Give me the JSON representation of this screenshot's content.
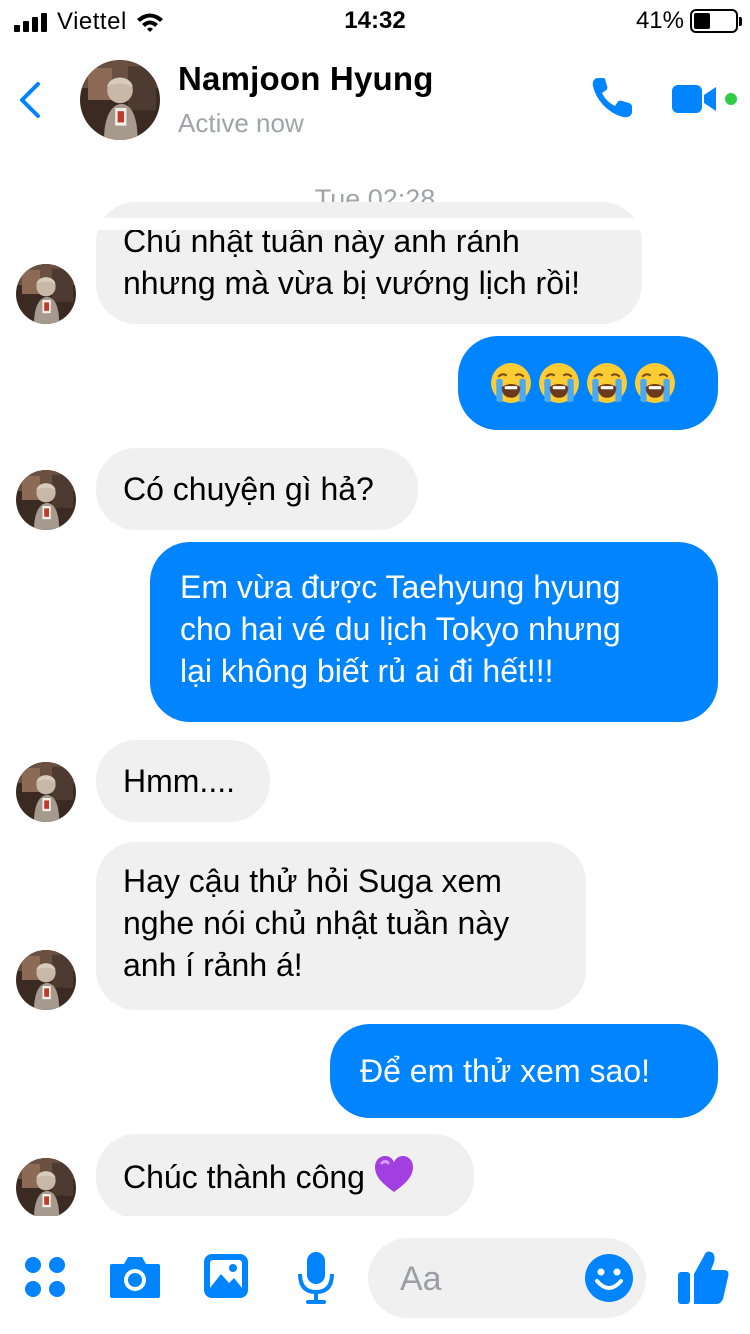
{
  "status_bar": {
    "carrier": "Viettel",
    "time": "14:32",
    "battery_percent": "41%",
    "battery_level": 0.41
  },
  "header": {
    "contact_name": "Namjoon Hyung",
    "status": "Active now"
  },
  "chat": {
    "timestamp": "Tue 02:28",
    "messages": [
      {
        "direction": "incoming",
        "lines": [
          "Chủ nhật tuần này anh rảnh",
          "nhưng mà vừa bị vướng lịch rồi!"
        ]
      },
      {
        "direction": "outgoing",
        "emoji": [
          "loudly-crying-face",
          "loudly-crying-face",
          "loudly-crying-face",
          "loudly-crying-face"
        ]
      },
      {
        "direction": "incoming",
        "lines": [
          "Có chuyện gì hả?"
        ]
      },
      {
        "direction": "outgoing",
        "lines": [
          "Em vừa được Taehyung hyung",
          "cho hai vé du lịch Tokyo nhưng",
          "lại không biết rủ ai đi hết!!!"
        ]
      },
      {
        "direction": "incoming",
        "lines": [
          "Hmm...."
        ]
      },
      {
        "direction": "incoming",
        "lines": [
          "Hay cậu thử hỏi Suga xem",
          "nghe nói chủ nhật tuần này",
          "anh í rảnh á!"
        ]
      },
      {
        "direction": "outgoing",
        "lines": [
          "Để em thử xem sao!"
        ]
      },
      {
        "direction": "incoming",
        "lines": [
          "Chúc thành công"
        ],
        "emoji": [
          "purple-heart"
        ]
      }
    ]
  },
  "composer": {
    "placeholder": "Aa",
    "icons": [
      "apps-icon",
      "camera-icon",
      "gallery-icon",
      "microphone-icon",
      "emoji-icon",
      "thumbs-up-icon"
    ]
  },
  "colors": {
    "accent": "#0084ff",
    "incoming_bubble": "#f0f0f0",
    "muted_text": "#a0a3a8",
    "online_dot": "#31cc46"
  }
}
